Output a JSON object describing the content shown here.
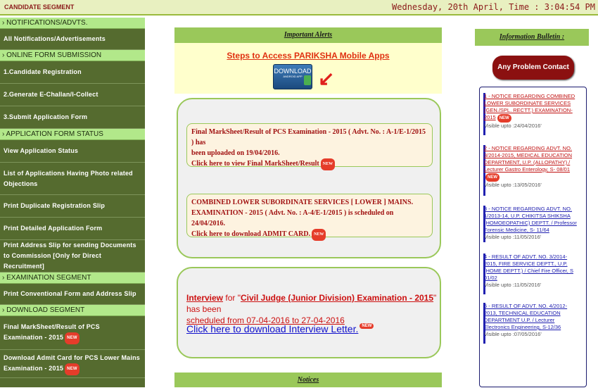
{
  "topbar": {
    "segment": "CANDIDATE SEGMENT",
    "datetime": "Wednesday, 20th April, Time : 3:04:54 PM"
  },
  "sidebar": {
    "sections": [
      {
        "header": "NOTIFICATIONS/ADVTS.",
        "items": [
          {
            "label": "All Notifications/Advertisements",
            "new": false
          }
        ]
      },
      {
        "header": "ONLINE FORM SUBMISSION",
        "items": [
          {
            "label": "1.Candidate Registration",
            "new": false
          },
          {
            "label": "2.Generate E-Challan/I-Collect",
            "new": false
          },
          {
            "label": "3.Submit Application Form",
            "new": false
          }
        ]
      },
      {
        "header": "APPLICATION FORM STATUS",
        "items": [
          {
            "label": "View Application Status",
            "new": false
          },
          {
            "label": "List of Applications Having Photo related Objections",
            "new": false
          },
          {
            "label": "Print Duplicate Registration Slip",
            "new": false
          },
          {
            "label": "Print Detailed Application Form",
            "new": false
          },
          {
            "label": "Print Address Slip for sending Documents to Commission [Only for Direct Recruitment]",
            "new": false
          }
        ]
      },
      {
        "header": "EXAMINATION SEGMENT",
        "items": [
          {
            "label": "Print Conventional Form and Address Slip",
            "new": false
          }
        ]
      },
      {
        "header": "DOWNLOAD SEGMENT",
        "items": [
          {
            "label": "Final MarkSheet/Result of PCS Examination - 2015",
            "new": true
          },
          {
            "label": "Download Admit Card for PCS Lower Mains Examination - 2015",
            "new": true
          }
        ]
      }
    ],
    "new_badge": "NEW"
  },
  "center": {
    "important_alerts": "Important Alerts",
    "steps_link": "Steps to Access PARIKSHA Mobile Apps",
    "download_btn": "DOWNLOAD",
    "download_sub": "ANDROID APP",
    "notice1_line1": "Final MarkSheet/Result of PCS Examination - 2015 ( Advt. No. : A-1/E-1/2015 ) has",
    "notice1_line2": "been uploaded on 19/04/2016.",
    "notice1_link": "Click here to view Final MarkSheet/Result",
    "notice2_line1": "COMBINED LOWER SUBORDINATE SERVICES [ LOWER ] MAINS.",
    "notice2_line2": "EXAMINATION - 2015 ( Advt. No. : A-4/E-1/2015 ) is scheduled on 24/04/2016.",
    "notice2_link": "Click here to download ADMIT CARD.",
    "interview_word": "Interview",
    "interview_for": " for \"",
    "interview_exam": "Civil Judge (Junior Division) Examination - 2015",
    "interview_rest": "\" has been",
    "interview_line2": "scheduled from 07-04-2016 to 27-04-2016",
    "interview_link": "Click here to download Interview Letter.",
    "notices": "Notices"
  },
  "right": {
    "info_bulletin": "Information Bulletin :",
    "problem_btn": "Any Problem Contact US",
    "bulletin_items": [
      {
        "title": "1 - NOTICE REGARDING COMBINED LOWER SUBORDINATE SERVICES (GEN./SPL. RECTT.) EXAMINATION-2015",
        "visible": "Visible upto :24/04/2016'",
        "color": "red"
      },
      {
        "title": "2 - NOTICE REGARDING ADVT. NO. 3/2014-2015, MEDICAL EDUCATION DEPARTMENT, U.P. (ALLOPATHY) / Lecturer Gastro Enterology, S- 08/01",
        "visible": "Visible upto :13/05/2016'",
        "color": "red"
      },
      {
        "title": "3 - NOTICE REGARDING ADVT. NO. 1/2013-14, U.P. CHIKITSA SHIKSHA (HOMOEOPATHIC) DEPTT. / Professor Forensic Medicine, S- 11/64",
        "visible": "Visible upto :11/05/2016'",
        "color": "blue"
      },
      {
        "title": "4 - RESULT OF ADVT. NO. 3/2014-2015, FIRE SERVICE DEPTT., U.P. (HOME DEPTT.) / Chief Fire Officer, S 01/02",
        "visible": "Visible upto :11/05/2016'",
        "color": "blue"
      },
      {
        "title": "5 - RESULT OF ADVT. NO. 4/2012-2013, TECHNICAL EDUCATION DEPARTMENT U.P. / Lecturer Electronics Engineering, S-12/36",
        "visible": "Visible upto :07/05/2016'",
        "color": "blue"
      }
    ]
  }
}
